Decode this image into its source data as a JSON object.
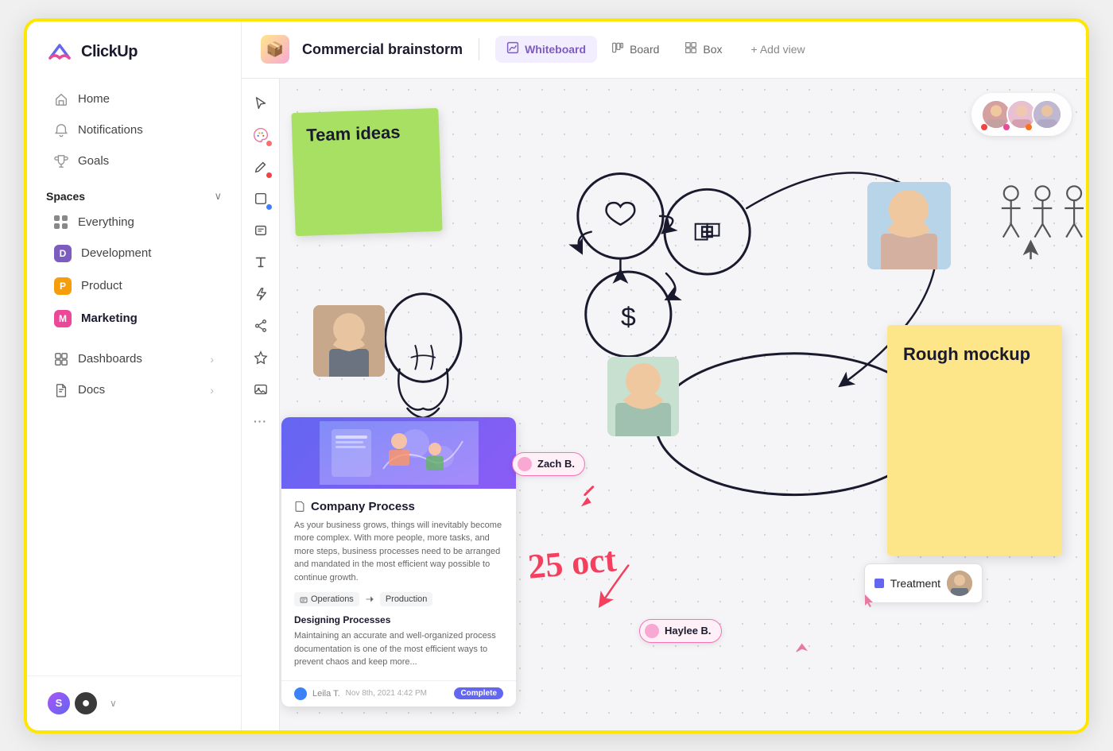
{
  "app": {
    "logo_text": "ClickUp",
    "logo_icon": "⬡"
  },
  "sidebar": {
    "nav_items": [
      {
        "id": "home",
        "label": "Home",
        "icon": "🏠"
      },
      {
        "id": "notifications",
        "label": "Notifications",
        "icon": "🔔"
      },
      {
        "id": "goals",
        "label": "Goals",
        "icon": "🏆"
      }
    ],
    "spaces_label": "Spaces",
    "spaces": [
      {
        "id": "everything",
        "label": "Everything",
        "type": "grid",
        "color": ""
      },
      {
        "id": "development",
        "label": "Development",
        "type": "letter",
        "letter": "D",
        "color": "#7c5cbf"
      },
      {
        "id": "product",
        "label": "Product",
        "type": "letter",
        "letter": "P",
        "color": "#f59e0b"
      },
      {
        "id": "marketing",
        "label": "Marketing",
        "type": "letter",
        "letter": "M",
        "color": "#ec4899",
        "bold": true
      }
    ],
    "sub_nav": [
      {
        "id": "dashboards",
        "label": "Dashboards"
      },
      {
        "id": "docs",
        "label": "Docs"
      }
    ],
    "footer": {
      "avatar1": "S",
      "avatar2": "●"
    }
  },
  "header": {
    "project_icon": "📦",
    "title": "Commercial brainstorm",
    "tabs": [
      {
        "id": "whiteboard",
        "label": "Whiteboard",
        "icon": "✏",
        "active": true
      },
      {
        "id": "board",
        "label": "Board",
        "icon": "▦"
      },
      {
        "id": "box",
        "label": "Box",
        "icon": "⊞"
      }
    ],
    "add_view_label": "+ Add view"
  },
  "whiteboard": {
    "sticky_green_text": "Team ideas",
    "sticky_yellow_text": "Rough mockup",
    "date_text": "25 oct",
    "doc_card": {
      "title": "Company Process",
      "body": "As your business grows, things will inevitably become more complex. With more people, more tasks, and more steps, business processes need to be arranged and mandated in the most efficient way possible to continue growth.",
      "tag1": "Operations",
      "tag2": "Production",
      "section_title": "Designing Processes",
      "section_text": "Maintaining an accurate and well-organized process documentation is one of the most efficient ways to prevent chaos and keep more...",
      "footer_user": "Leila T.",
      "footer_date": "Nov 8th, 2021 4:42 PM",
      "footer_badge": "Complete"
    },
    "users": [
      {
        "id": "zach",
        "label": "Zach B.",
        "color": "#f472b6"
      },
      {
        "id": "haylee",
        "label": "Haylee B.",
        "color": "#f472b6"
      }
    ],
    "treatment_label": "Treatment",
    "collaborators": [
      {
        "id": "c1",
        "class": "c1"
      },
      {
        "id": "c2",
        "class": "c2"
      },
      {
        "id": "c3",
        "class": "c3"
      }
    ],
    "collab_dots": [
      {
        "color": "#ef4444"
      },
      {
        "color": "#ec4899"
      },
      {
        "color": "#f97316"
      }
    ]
  },
  "toolbar": {
    "tools": [
      {
        "id": "select",
        "icon": "↗",
        "dot": null
      },
      {
        "id": "palette",
        "icon": "✦",
        "dot": null
      },
      {
        "id": "pen",
        "icon": "✏",
        "dot": "#ef4444"
      },
      {
        "id": "rect",
        "icon": "□",
        "dot": "#3b82f6"
      },
      {
        "id": "note",
        "icon": "▭",
        "dot": "#f59e0b"
      },
      {
        "id": "text",
        "icon": "T",
        "dot": null
      },
      {
        "id": "lightning",
        "icon": "⚡",
        "dot": null
      },
      {
        "id": "share",
        "icon": "⊙",
        "dot": null
      },
      {
        "id": "star",
        "icon": "✵",
        "dot": null
      },
      {
        "id": "image",
        "icon": "⬜",
        "dot": null
      },
      {
        "id": "more",
        "icon": "···",
        "dot": null
      }
    ]
  }
}
